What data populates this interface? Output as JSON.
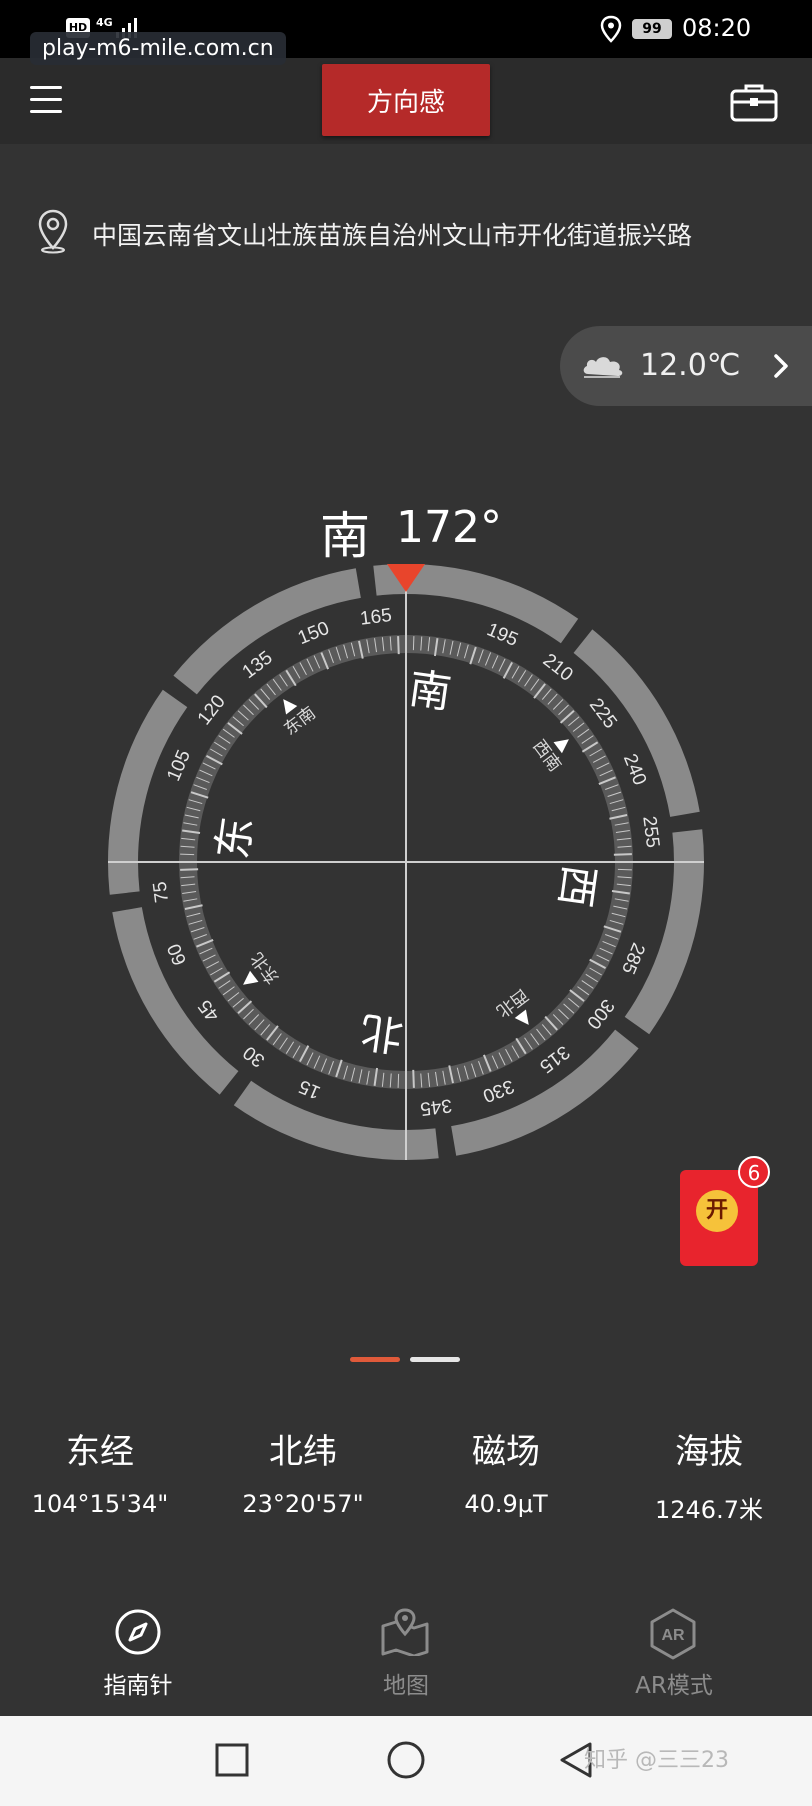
{
  "status_bar": {
    "hd": "HD",
    "network": "4G",
    "battery": "99",
    "time": "08:20"
  },
  "watermark": "play-m6-mile.com.cn",
  "header": {
    "title": "方向感"
  },
  "location": {
    "address": "中国云南省文山壮族苗族自治州文山市开化街道振兴路"
  },
  "weather": {
    "temperature": "12.0℃"
  },
  "heading": {
    "direction": "南",
    "degrees": "172°"
  },
  "compass": {
    "heading_deg": 172,
    "cardinals": [
      {
        "label": "北",
        "angle": 0
      },
      {
        "label": "东",
        "angle": 90
      },
      {
        "label": "南",
        "angle": 180
      },
      {
        "label": "西",
        "angle": 270
      }
    ],
    "intercardinals": [
      {
        "label": "东北",
        "angle": 45
      },
      {
        "label": "东南",
        "angle": 135
      },
      {
        "label": "西南",
        "angle": 225
      },
      {
        "label": "西北",
        "angle": 315
      }
    ],
    "degree_labels": [
      "15",
      "30",
      "45",
      "60",
      "75",
      "105",
      "120",
      "135",
      "150",
      "165",
      "195",
      "210",
      "225",
      "240",
      "255",
      "285",
      "300",
      "315",
      "330",
      "345"
    ],
    "accent_color": "#e8452c",
    "ring_color": "#8a8a8a"
  },
  "red_packet": {
    "coin_label": "开",
    "badge": "6"
  },
  "info": [
    {
      "label": "东经",
      "value": "104°15'34\""
    },
    {
      "label": "北纬",
      "value": "23°20'57\""
    },
    {
      "label": "磁场",
      "value": "40.9μT"
    },
    {
      "label": "海拔",
      "value": "1246.7米"
    }
  ],
  "bottom_nav": [
    {
      "label": "指南针",
      "icon": "compass-icon",
      "active": true
    },
    {
      "label": "地图",
      "icon": "map-icon",
      "active": false
    },
    {
      "label": "AR模式",
      "icon": "ar-icon",
      "active": false,
      "icon_text": "AR"
    }
  ],
  "system_watermark": "知乎 @三三23"
}
